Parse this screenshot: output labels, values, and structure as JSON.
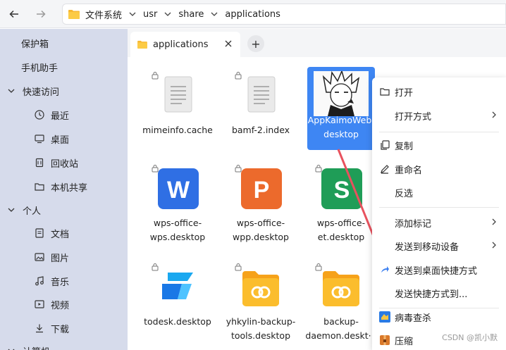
{
  "toolbar": {
    "path": [
      "文件系统",
      "usr",
      "share",
      "applications"
    ]
  },
  "sidebar": {
    "items": [
      {
        "label": "保护箱",
        "icon": "none",
        "indent": false
      },
      {
        "label": "手机助手",
        "icon": "none",
        "indent": false
      },
      {
        "label": "快速访问",
        "icon": "chevron-down",
        "indent": false
      },
      {
        "label": "最近",
        "icon": "clock-icon",
        "indent": true
      },
      {
        "label": "桌面",
        "icon": "desktop-icon",
        "indent": true
      },
      {
        "label": "回收站",
        "icon": "trash-icon",
        "indent": true
      },
      {
        "label": "本机共享",
        "icon": "folder-icon",
        "indent": true
      },
      {
        "label": "个人",
        "icon": "chevron-down",
        "indent": false
      },
      {
        "label": "文档",
        "icon": "document-icon",
        "indent": true
      },
      {
        "label": "图片",
        "icon": "picture-icon",
        "indent": true
      },
      {
        "label": "音乐",
        "icon": "music-icon",
        "indent": true
      },
      {
        "label": "视频",
        "icon": "video-icon",
        "indent": true
      },
      {
        "label": "下载",
        "icon": "download-icon",
        "indent": true
      },
      {
        "label": "计算机",
        "icon": "chevron-down",
        "indent": false
      }
    ]
  },
  "tab": {
    "label": "applications"
  },
  "files": [
    {
      "name1": "mimeinfo.cache",
      "name2": "",
      "icon": "text-file-icon"
    },
    {
      "name1": "bamf-2.index",
      "name2": "",
      "icon": "text-file-icon"
    },
    {
      "name1": "AppKaimoWeb.",
      "name2": "desktop",
      "icon": "anime-avatar-icon",
      "selected": true
    },
    {
      "name1": "wps-office-",
      "name2": "wps.desktop",
      "icon": "wps-writer-icon",
      "letter": "W"
    },
    {
      "name1": "wps-office-",
      "name2": "wpp.desktop",
      "icon": "wps-presentation-icon",
      "letter": "P"
    },
    {
      "name1": "wps-office-",
      "name2": "et.desktop",
      "icon": "wps-spreadsheet-icon",
      "letter": "S"
    },
    {
      "name1": "todesk.desktop",
      "name2": "",
      "icon": "todesk-icon"
    },
    {
      "name1": "yhkylin-backup-",
      "name2": "tools.desktop",
      "icon": "backup-tools-icon"
    },
    {
      "name1": "backup-",
      "name2": "daemon.deskt···",
      "icon": "backup-daemon-icon"
    }
  ],
  "menu": {
    "items": [
      {
        "label": "打开",
        "icon": "open-icon",
        "arrow": false
      },
      {
        "label": "打开方式",
        "icon": "none",
        "arrow": true
      },
      {
        "label": "复制",
        "icon": "copy-icon",
        "arrow": false
      },
      {
        "label": "重命名",
        "icon": "rename-icon",
        "arrow": false
      },
      {
        "label": "反选",
        "icon": "none",
        "arrow": false
      },
      {
        "label": "添加标记",
        "icon": "none",
        "arrow": true
      },
      {
        "label": "发送到移动设备",
        "icon": "none",
        "arrow": true
      },
      {
        "label": "发送到桌面快捷方式",
        "icon": "share-arrow-icon",
        "arrow": false
      },
      {
        "label": "发送快捷方式到...",
        "icon": "none",
        "arrow": false
      },
      {
        "label": "病毒查杀",
        "icon": "antivirus-icon",
        "arrow": false
      },
      {
        "label": "压缩",
        "icon": "compress-icon",
        "arrow": false
      }
    ]
  },
  "watermark": "CSDN @凯小默",
  "colors": {
    "sidebar_bg": "#d6dbeb",
    "selection": "#3e86f3",
    "arrow_annotation": "#e8525e"
  }
}
